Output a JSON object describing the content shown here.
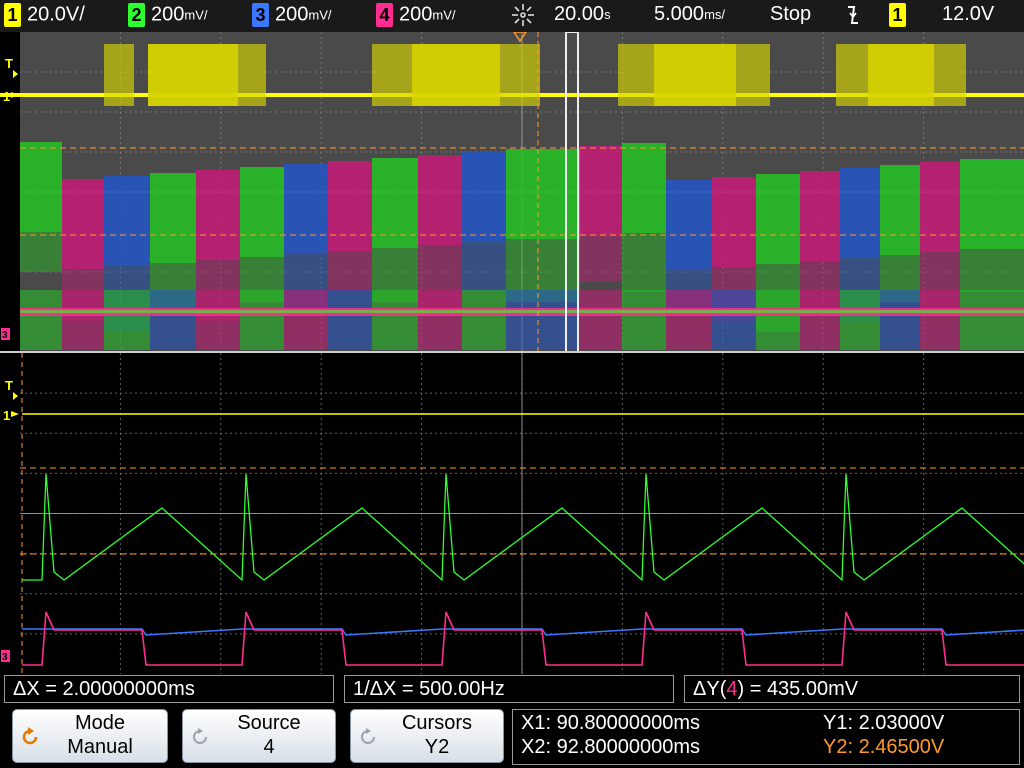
{
  "topbar": {
    "ch1": {
      "num": "1",
      "scale": "20.0V/",
      "color": "#ffff00"
    },
    "ch2": {
      "num": "2",
      "scale": "200",
      "unit": "mV/",
      "color": "#2dff2d"
    },
    "ch3": {
      "num": "3",
      "scale": "200",
      "unit": "mV/",
      "color": "#3c78ff"
    },
    "ch4": {
      "num": "4",
      "scale": "200",
      "unit": "mV/",
      "color": "#ff2d8f"
    },
    "acq_icon": "acquisition-sparkle-icon",
    "time_delay": "20.00",
    "time_delay_unit": "s",
    "time_scale": "5.000",
    "time_scale_unit": "ms/",
    "run_state": "Stop",
    "trigger_slope_icon": "falling-edge-icon",
    "trigger_source": "1",
    "trigger_level": "12.0V"
  },
  "markers": {
    "trigger": "T",
    "ch1": "1",
    "ground": "3"
  },
  "measurements": {
    "delta_x": "ΔX = 2.00000000ms",
    "inv_delta_x": "1/ΔX = 500.00Hz",
    "delta_y_prefix": "ΔY(",
    "delta_y_channel": "4",
    "delta_y_suffix": ") = 435.00mV"
  },
  "softkeys": {
    "mode": {
      "label": "Mode",
      "value": "Manual",
      "icon": "rotate-knob-icon"
    },
    "source": {
      "label": "Source",
      "value": "4",
      "icon": "rotate-knob-icon"
    },
    "cursors": {
      "label": "Cursors",
      "value": "Y2",
      "icon": "rotate-knob-icon"
    }
  },
  "cursor_readout": {
    "x1": "X1: 90.80000000ms",
    "x2": "X2: 92.80000000ms",
    "y1": "Y1: 2.03000V",
    "y2": "Y2: 2.46500V"
  },
  "colors": {
    "ch1": "#ffff00",
    "ch2": "#2dff2d",
    "ch3": "#3c78ff",
    "ch4": "#ff2d8f",
    "cursor": "#ff9a2a",
    "grid": "#9a9a9a",
    "zoom_background": "#4a4a4a"
  }
}
